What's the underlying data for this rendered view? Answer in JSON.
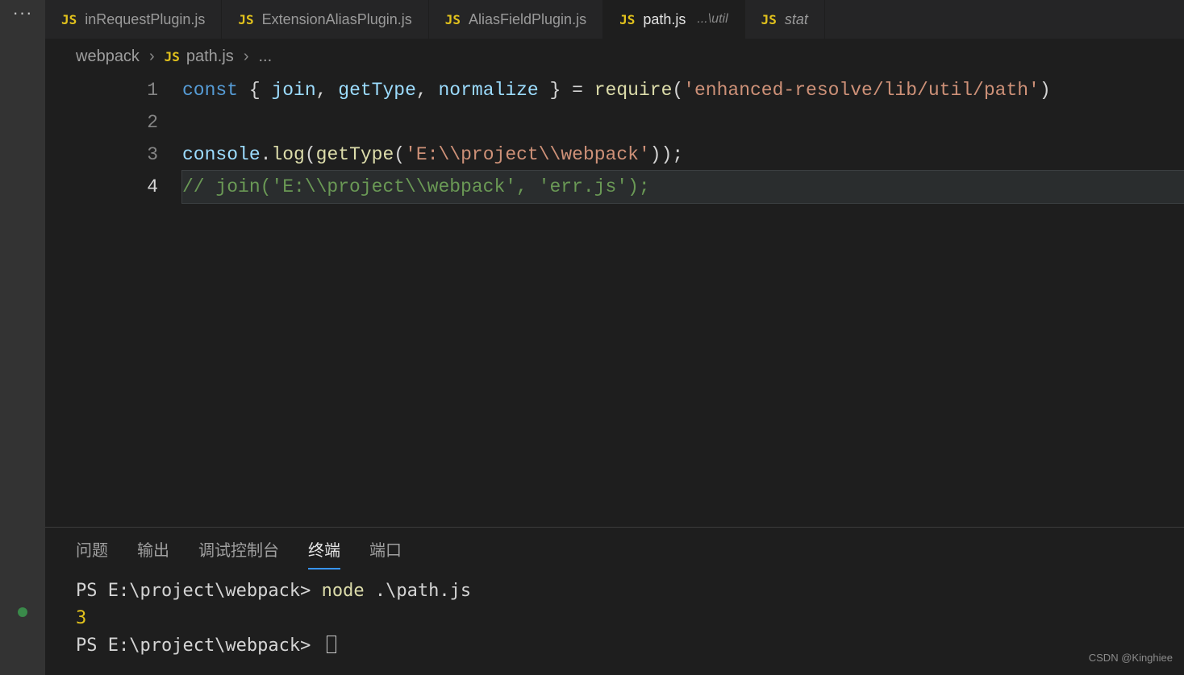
{
  "tabs": [
    {
      "icon": "JS",
      "name": "inRequestPlugin.js",
      "suffix": "",
      "active": false,
      "italic": false
    },
    {
      "icon": "JS",
      "name": "ExtensionAliasPlugin.js",
      "suffix": "",
      "active": false,
      "italic": false
    },
    {
      "icon": "JS",
      "name": "AliasFieldPlugin.js",
      "suffix": "",
      "active": false,
      "italic": false
    },
    {
      "icon": "JS",
      "name": "path.js",
      "suffix": "...\\util",
      "active": true,
      "italic": false
    },
    {
      "icon": "JS",
      "name": "stat",
      "suffix": "",
      "active": false,
      "italic": true
    }
  ],
  "breadcrumbs": {
    "parent": "webpack",
    "icon": "JS",
    "file": "path.js",
    "tail": "..."
  },
  "editor": {
    "current_line": 4,
    "lines": [
      {
        "tokens": [
          {
            "t": "kw",
            "v": "const"
          },
          {
            "t": "pn",
            "v": " { "
          },
          {
            "t": "id",
            "v": "join"
          },
          {
            "t": "pn",
            "v": ", "
          },
          {
            "t": "id",
            "v": "getType"
          },
          {
            "t": "pn",
            "v": ", "
          },
          {
            "t": "id",
            "v": "normalize"
          },
          {
            "t": "pn",
            "v": " } = "
          },
          {
            "t": "fn",
            "v": "require"
          },
          {
            "t": "pn",
            "v": "("
          },
          {
            "t": "str",
            "v": "'enhanced-resolve/lib/util/path'"
          },
          {
            "t": "pn",
            "v": ")"
          }
        ]
      },
      {
        "tokens": []
      },
      {
        "tokens": [
          {
            "t": "id",
            "v": "console"
          },
          {
            "t": "pn",
            "v": "."
          },
          {
            "t": "fn",
            "v": "log"
          },
          {
            "t": "pn",
            "v": "("
          },
          {
            "t": "fn",
            "v": "getType"
          },
          {
            "t": "pn",
            "v": "("
          },
          {
            "t": "str",
            "v": "'E:\\\\project\\\\webpack'"
          },
          {
            "t": "pn",
            "v": "));"
          }
        ]
      },
      {
        "tokens": [
          {
            "t": "cmt",
            "v": "// join('E:\\\\project\\\\webpack', 'err.js');"
          }
        ]
      }
    ]
  },
  "panel": {
    "tabs": [
      "问题",
      "输出",
      "调试控制台",
      "终端",
      "端口"
    ],
    "active": "终端",
    "terminal": {
      "prompt1_path": "PS E:\\project\\webpack> ",
      "prompt1_cmd_a": "node ",
      "prompt1_cmd_b": ".\\path.js",
      "output": "3",
      "prompt2_path": "PS E:\\project\\webpack> "
    }
  },
  "watermark": "CSDN @Kinghiee"
}
